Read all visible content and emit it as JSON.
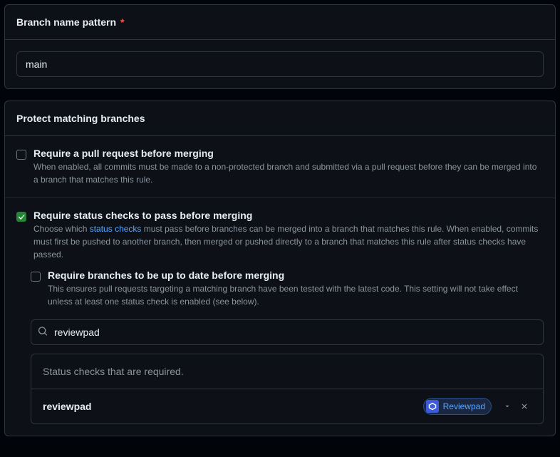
{
  "pattern": {
    "label": "Branch name pattern",
    "required_mark": "*",
    "value": "main"
  },
  "protect": {
    "header": "Protect matching branches",
    "rules": {
      "require_pr": {
        "title": "Require a pull request before merging",
        "desc": "When enabled, all commits must be made to a non-protected branch and submitted via a pull request before they can be merged into a branch that matches this rule."
      },
      "require_status": {
        "title": "Require status checks to pass before merging",
        "desc_pre": "Choose which ",
        "desc_link": "status checks",
        "desc_post": " must pass before branches can be merged into a branch that matches this rule. When enabled, commits must first be pushed to another branch, then merged or pushed directly to a branch that matches this rule after status checks have passed."
      },
      "require_up_to_date": {
        "title": "Require branches to be up to date before merging",
        "desc": "This ensures pull requests targeting a matching branch have been tested with the latest code. This setting will not take effect unless at least one status check is enabled (see below)."
      }
    },
    "search": {
      "value": "reviewpad"
    },
    "status_section_header": "Status checks that are required.",
    "status_items": [
      {
        "name": "reviewpad",
        "app": "Reviewpad"
      }
    ]
  }
}
